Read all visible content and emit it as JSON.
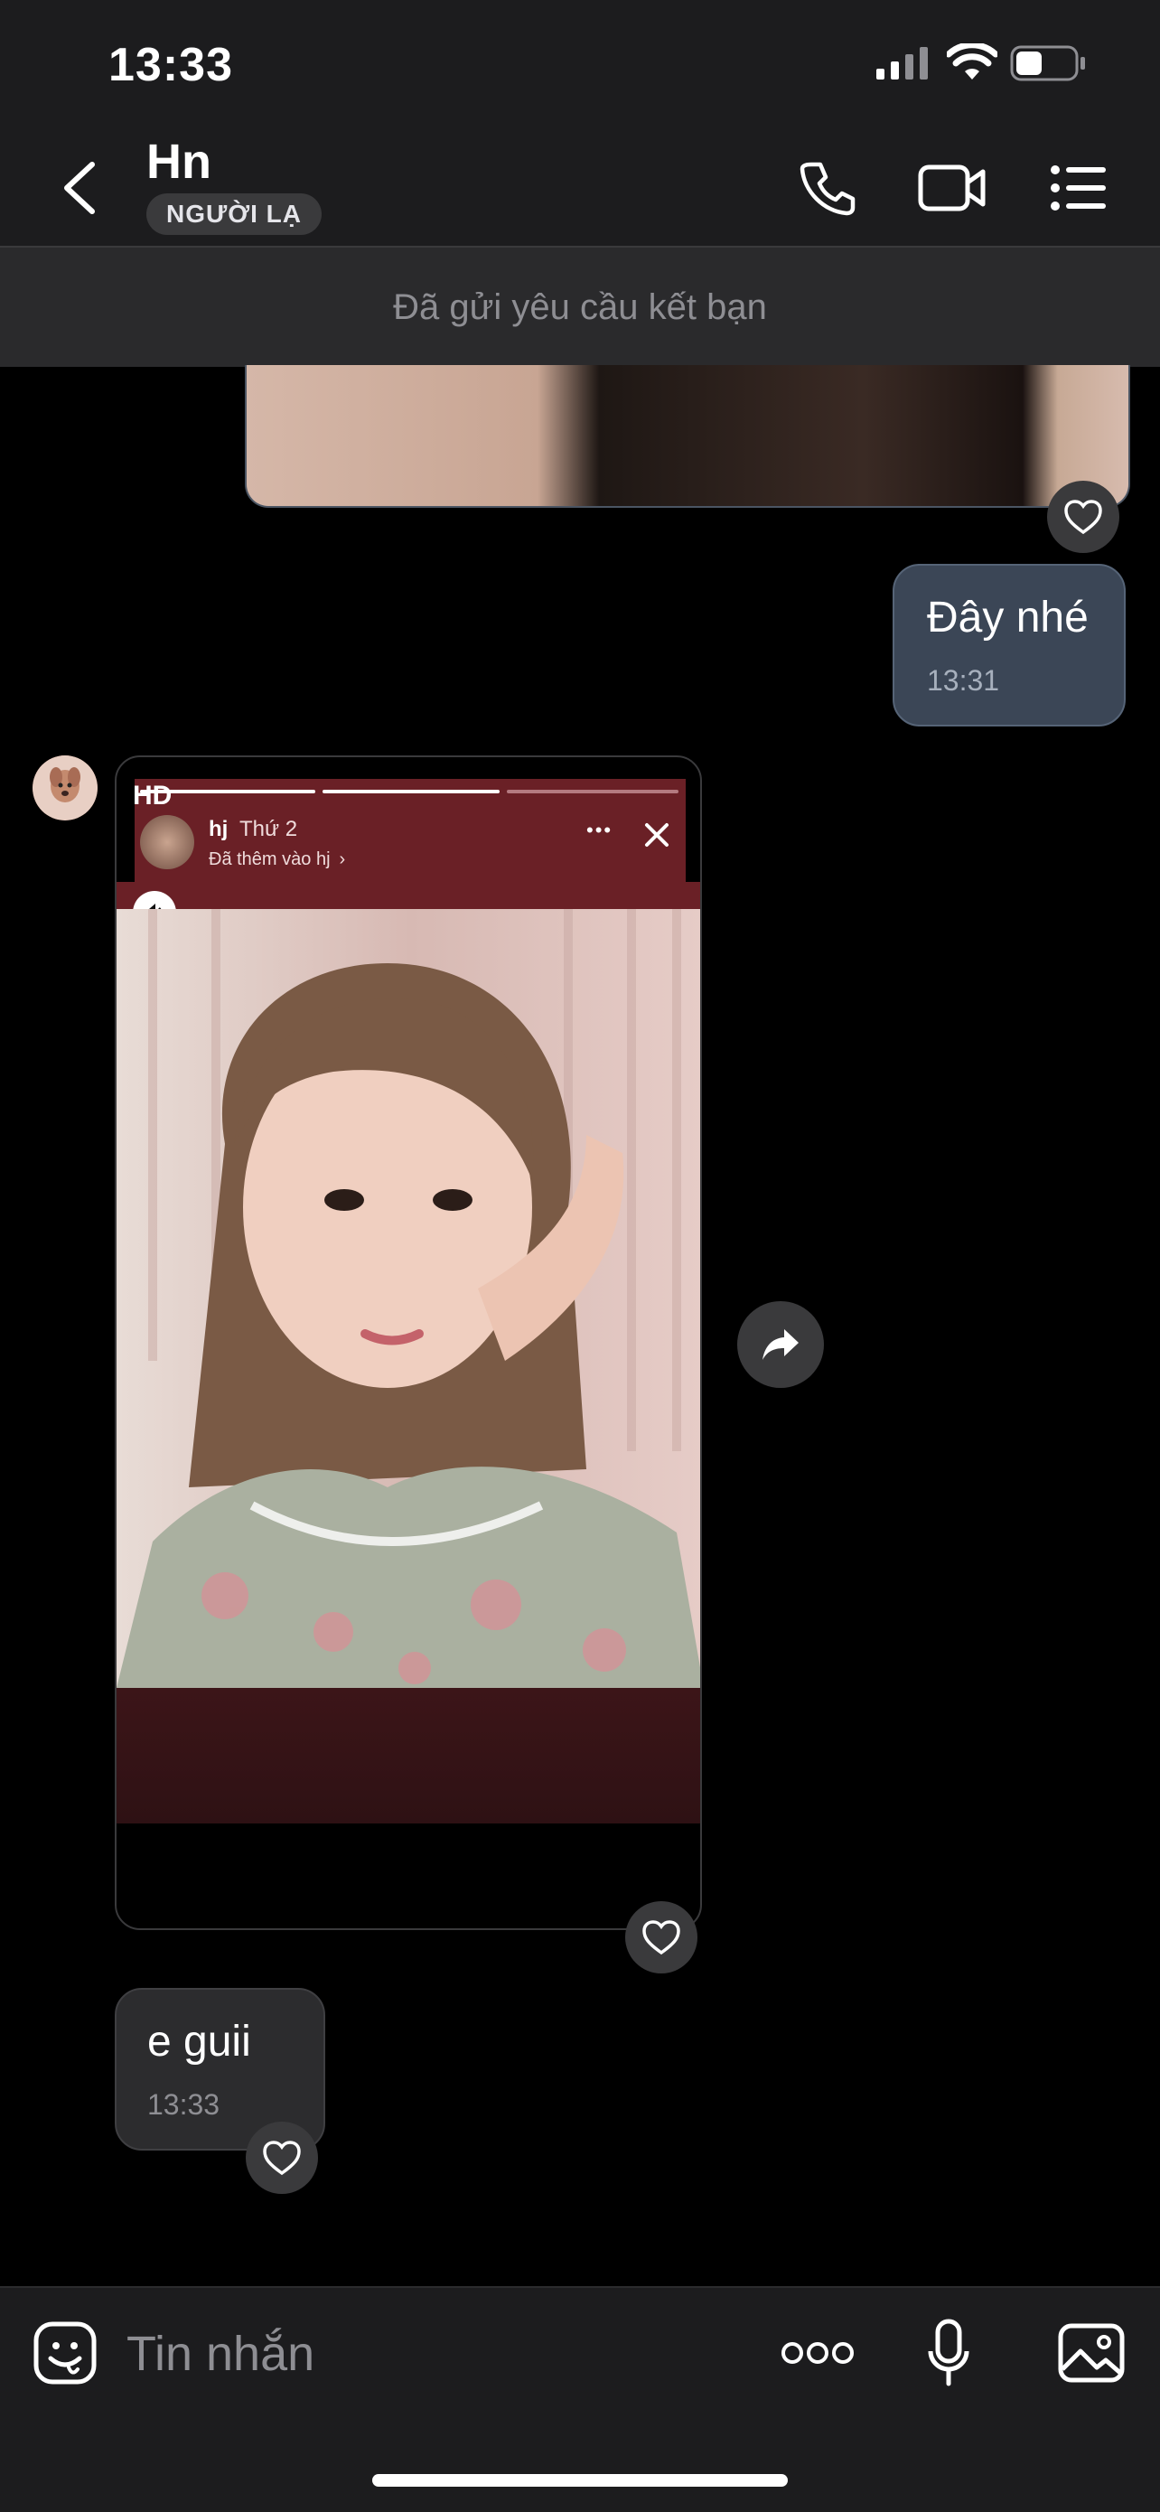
{
  "status_bar": {
    "time": "13:33",
    "battery_level": 0.45
  },
  "header": {
    "contact_name": "Hn",
    "badge": "NGƯỜI LẠ"
  },
  "friend_request_banner": "Đã gửi yêu cầu kết bạn",
  "messages": {
    "outgoing": {
      "text": "Đây nhé",
      "time": "13:31"
    },
    "story": {
      "quality_tag": "HD",
      "username": "hj",
      "day": "Thứ 2",
      "added_text": "Đã thêm vào hj",
      "more": "•••"
    },
    "incoming": {
      "text": "e guii",
      "time": "13:33"
    }
  },
  "input": {
    "placeholder": "Tin nhắn",
    "more": "ooo"
  },
  "colors": {
    "header_bg": "#1c1c1e",
    "outgoing_bubble": "#3b4656",
    "incoming_bubble": "#2c2c2e",
    "story_frame": "#6a2026"
  }
}
